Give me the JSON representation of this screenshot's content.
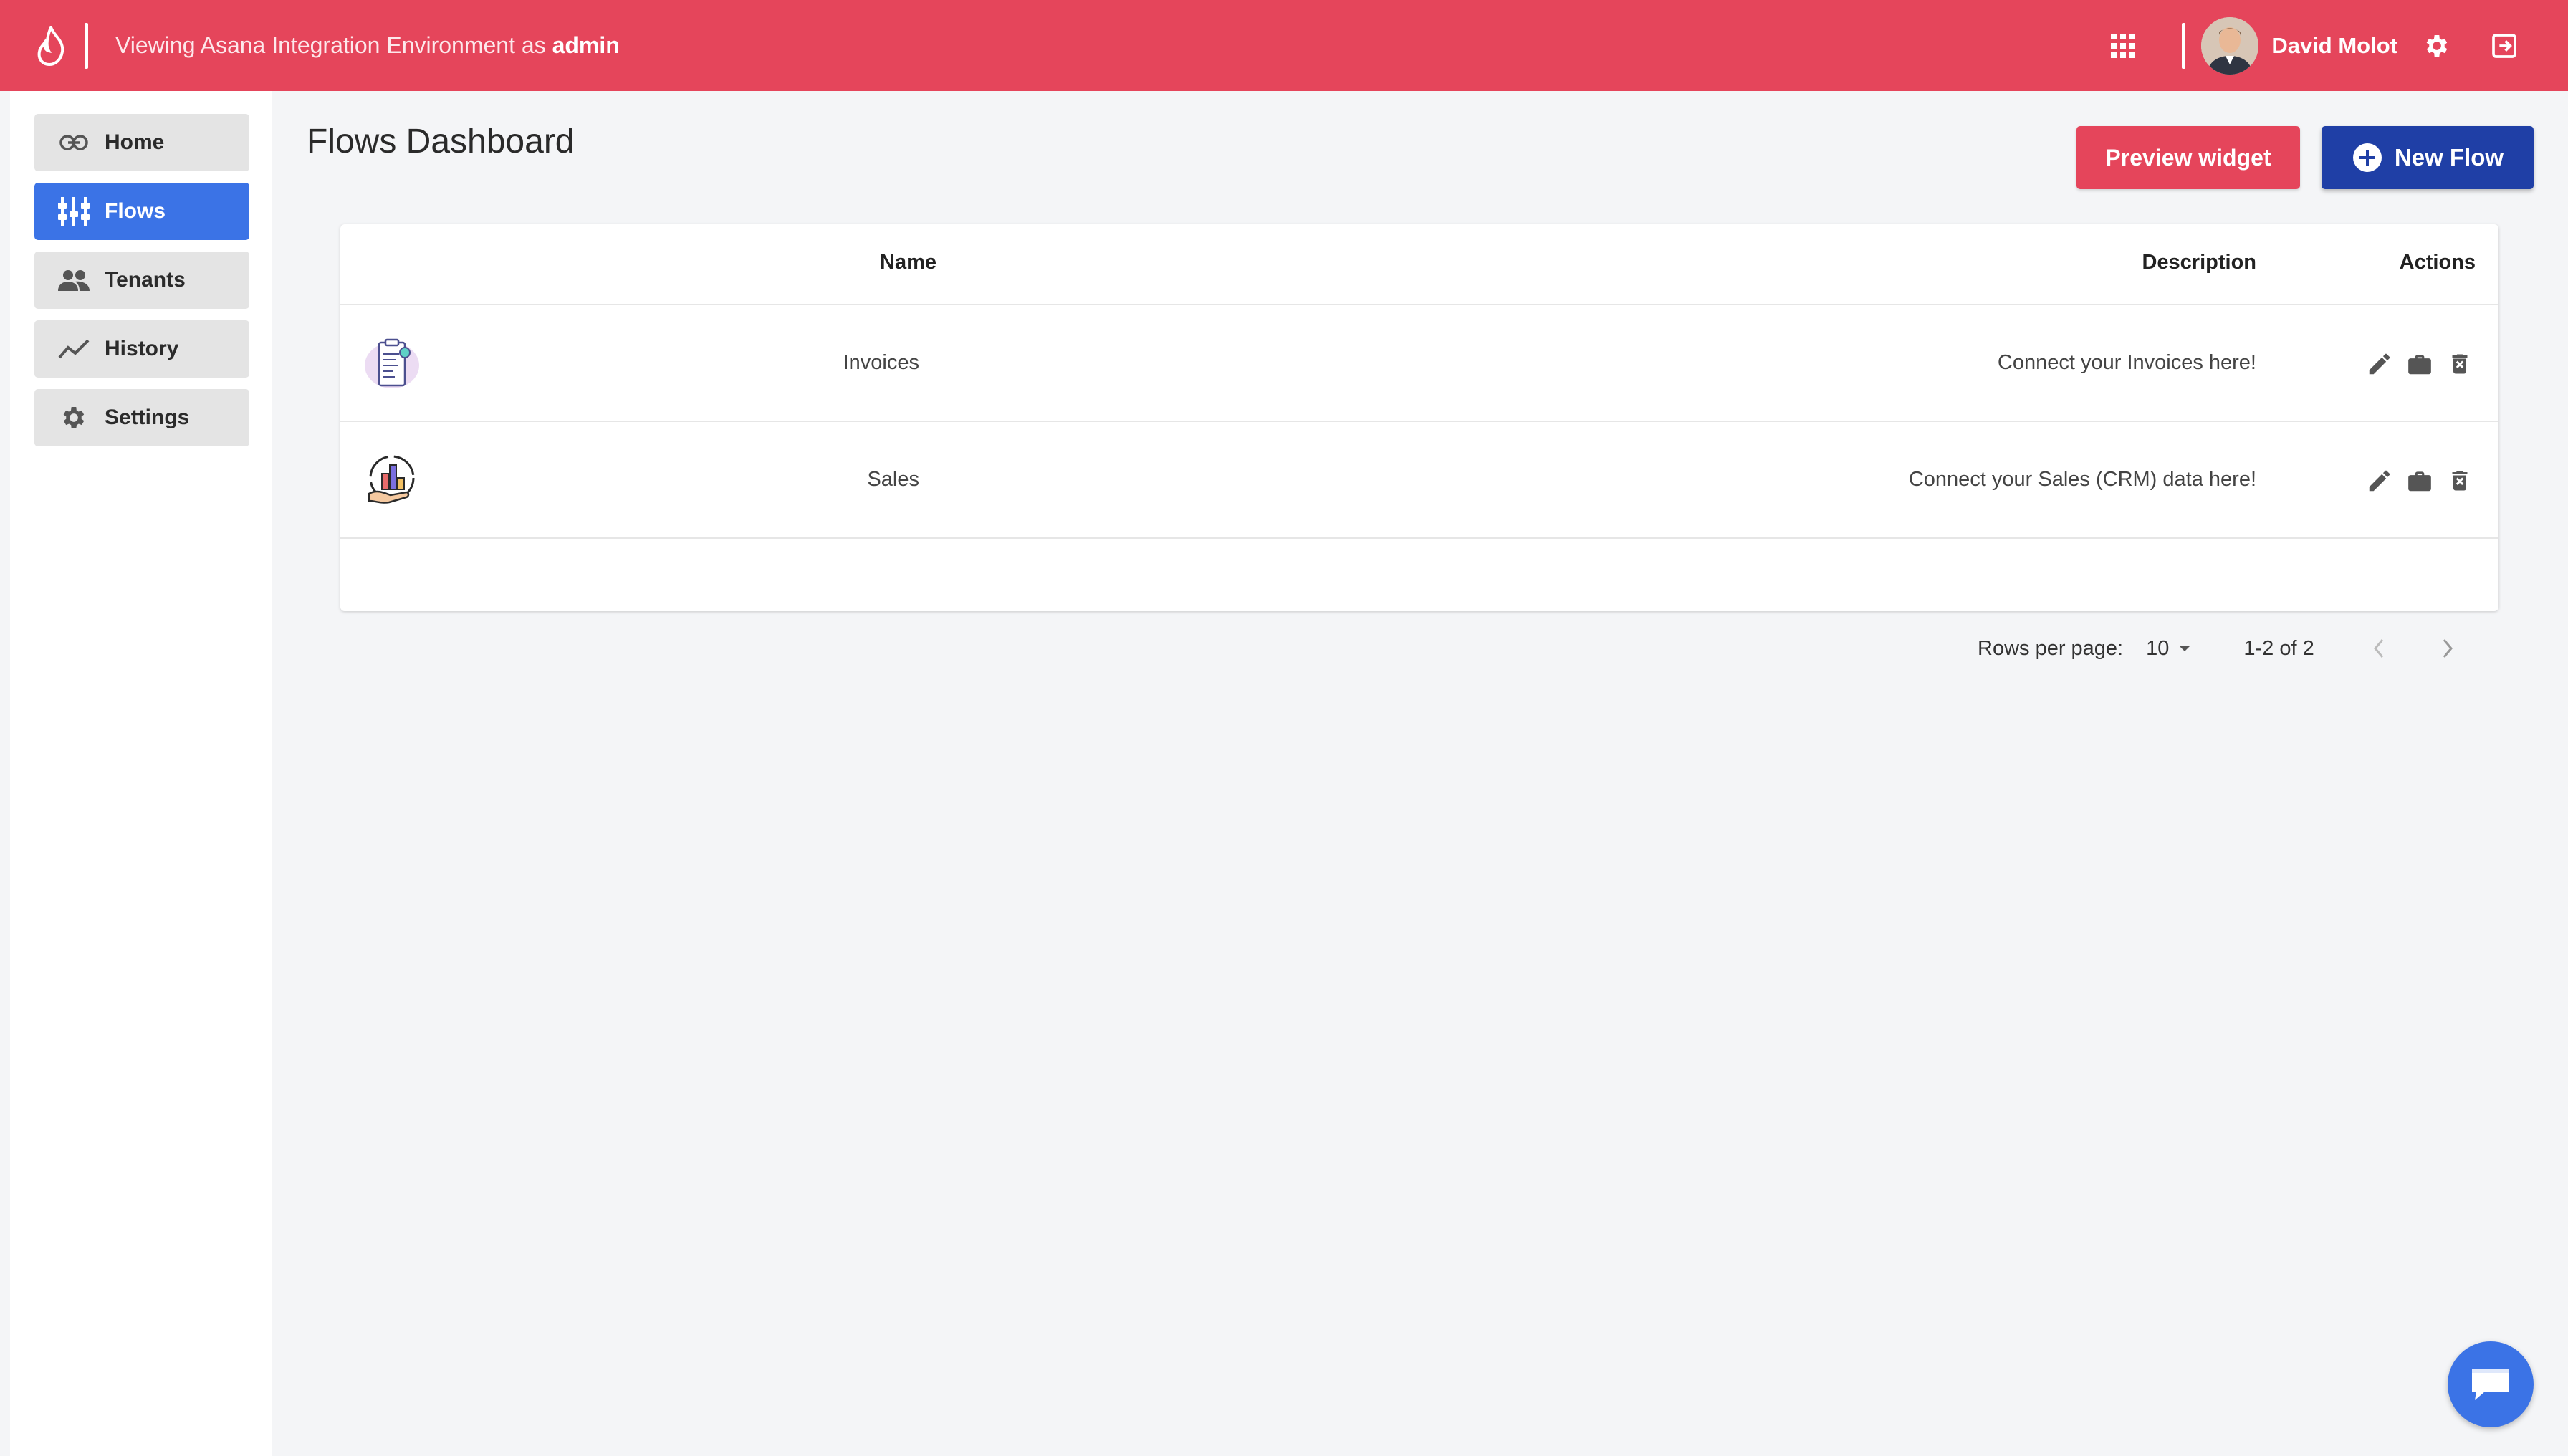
{
  "header": {
    "env_prefix": "Viewing Asana Integration Environment as",
    "env_role": "admin",
    "user_name": "David Molot",
    "icons": [
      "flame-logo-icon",
      "apps-grid-icon",
      "avatar",
      "gear-icon",
      "logout-icon"
    ]
  },
  "sidebar": {
    "items": [
      {
        "label": "Home",
        "icon": "link-icon",
        "active": false
      },
      {
        "label": "Flows",
        "icon": "flows-icon",
        "active": true
      },
      {
        "label": "Tenants",
        "icon": "people-icon",
        "active": false
      },
      {
        "label": "History",
        "icon": "trending-icon",
        "active": false
      },
      {
        "label": "Settings",
        "icon": "gear-icon",
        "active": false
      }
    ]
  },
  "main": {
    "title": "Flows Dashboard",
    "preview_label": "Preview widget",
    "new_flow_label": "New Flow",
    "table": {
      "columns": [
        "Name",
        "Description",
        "Actions"
      ],
      "rows": [
        {
          "name": "Invoices",
          "description": "Connect your Invoices here!",
          "icon": "invoice-icon"
        },
        {
          "name": "Sales",
          "description": "Connect your Sales (CRM) data here!",
          "icon": "sales-chart-icon"
        }
      ]
    },
    "pagination": {
      "rows_per_page_label": "Rows per page:",
      "rows_per_page": "10",
      "range": "1-2 of 2"
    }
  },
  "colors": {
    "header": "#e5455b",
    "primary": "#3b73e6",
    "new_flow": "#1f3fa6"
  }
}
